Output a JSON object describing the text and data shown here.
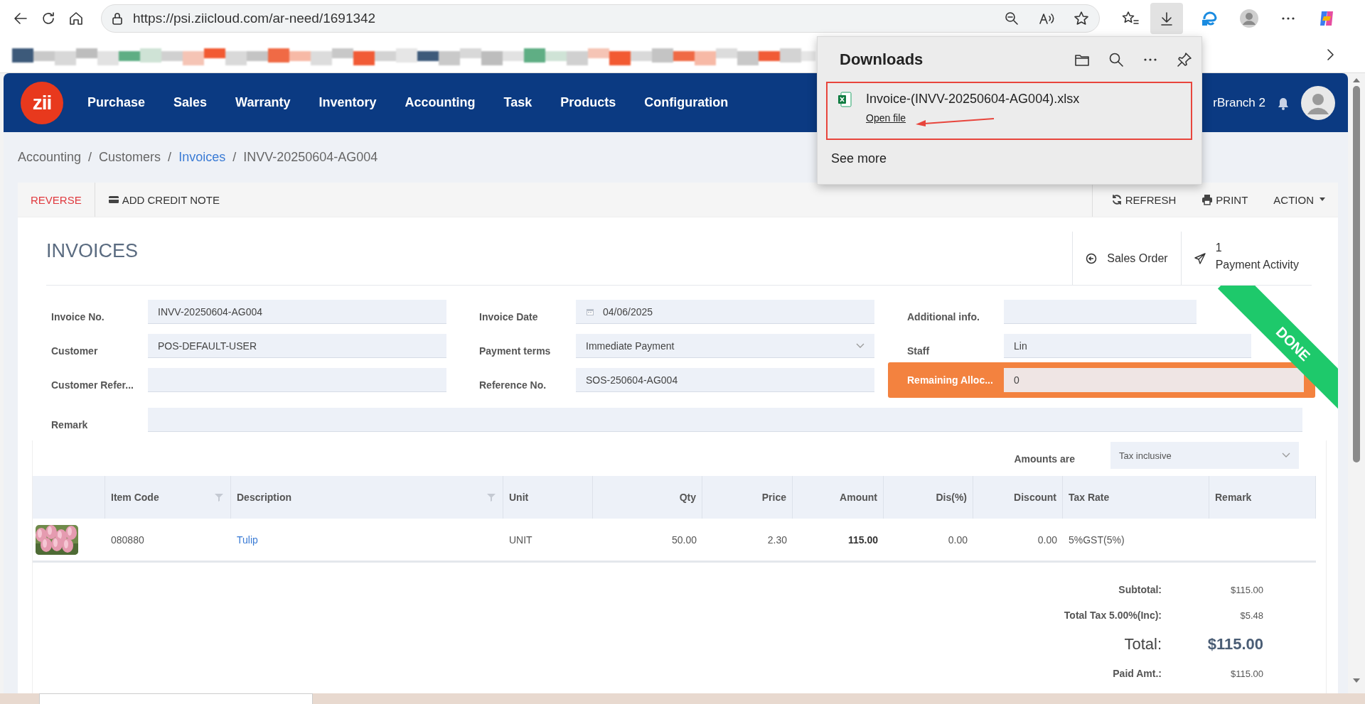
{
  "browser": {
    "url": "https://psi.ziicloud.com/ar-need/1691342"
  },
  "nav": {
    "logo": "zii",
    "items": [
      "Purchase",
      "Sales",
      "Warranty",
      "Inventory",
      "Accounting",
      "Task",
      "Products",
      "Configuration"
    ],
    "branch": "rBranch 2"
  },
  "downloads": {
    "title": "Downloads",
    "files": [
      {
        "name": "Invoice-(INVV-20250604-AG004).xlsx",
        "action": "Open file"
      }
    ],
    "more": "See more"
  },
  "breadcrumb": {
    "items": [
      {
        "label": "Accounting",
        "link": false
      },
      {
        "label": "Customers",
        "link": false
      },
      {
        "label": "Invoices",
        "link": true
      },
      {
        "label": "INVV-20250604-AG004",
        "link": false
      }
    ],
    "separators": [
      "/",
      "/",
      "/"
    ]
  },
  "toolbar": {
    "left": [
      {
        "label": "REVERSE",
        "kind": "danger"
      },
      {
        "label": "ADD CREDIT NOTE",
        "kind": "credit"
      }
    ],
    "right": [
      {
        "label": "REFRESH",
        "kind": "refresh"
      },
      {
        "label": "PRINT",
        "kind": "print"
      },
      {
        "label": "ACTION",
        "kind": "dropdown"
      }
    ]
  },
  "header": {
    "title": "INVOICES",
    "links": [
      {
        "label": "Sales Order",
        "kind": "back"
      },
      {
        "label": "Payment Activity",
        "count": "1",
        "kind": "send"
      }
    ]
  },
  "status_ribbon": "DONE",
  "fields": [
    {
      "label": "Invoice No.",
      "value": "INVV-20250604-AG004",
      "kind": "text"
    },
    {
      "label": "Invoice Date",
      "value": "04/06/2025",
      "kind": "date"
    },
    {
      "label": "Additional info.",
      "kind": "short"
    },
    {
      "label": "Customer",
      "value": "POS-DEFAULT-USER",
      "kind": "text"
    },
    {
      "label": "Payment terms",
      "value": "Immediate Payment",
      "kind": "select"
    },
    {
      "label": "Staff",
      "value": "Lin",
      "kind": "text"
    },
    {
      "label": "Customer Refer...",
      "kind": "text"
    },
    {
      "label": "Reference No.",
      "value": "SOS-250604-AG004",
      "kind": "text"
    },
    {
      "label": "Remaining Alloc...",
      "value": "0",
      "kind": "highlight"
    },
    {
      "label": "Remark",
      "kind": "wide"
    }
  ],
  "amounts_are": {
    "label": "Amounts are",
    "value": "Tax inclusive"
  },
  "table": {
    "columns": [
      {
        "label": "Item Code",
        "filter": true,
        "kind": "text"
      },
      {
        "label": "Description",
        "filter": true,
        "kind": "link"
      },
      {
        "label": "Unit",
        "filter": false,
        "kind": "text"
      },
      {
        "label": "Qty",
        "filter": false,
        "kind": "number"
      },
      {
        "label": "Price",
        "filter": false,
        "kind": "number"
      },
      {
        "label": "Amount",
        "filter": false,
        "kind": "strong"
      },
      {
        "label": "Dis(%)",
        "filter": false,
        "kind": "number"
      },
      {
        "label": "Discount",
        "filter": false,
        "kind": "number"
      },
      {
        "label": "Tax Rate",
        "filter": false,
        "kind": "text"
      },
      {
        "label": "Remark",
        "filter": false,
        "kind": "text"
      }
    ],
    "rows": [
      {
        "image": {
          "kind": "picture"
        },
        "cells": [
          "080880",
          "Tulip",
          "UNIT",
          "50.00",
          "2.30",
          "115.00",
          "0.00",
          "0.00",
          "5%GST(5%)"
        ]
      }
    ]
  },
  "totals": [
    {
      "label": "Subtotal:",
      "value": "$115.00",
      "kind": "normal"
    },
    {
      "label": "Total Tax 5.00%(Inc):",
      "value": "$5.48",
      "kind": "normal"
    },
    {
      "label": "Total:",
      "value": "$115.00",
      "kind": "grand"
    },
    {
      "label": "Paid Amt.:",
      "value": "$115.00",
      "kind": "normal"
    }
  ]
}
